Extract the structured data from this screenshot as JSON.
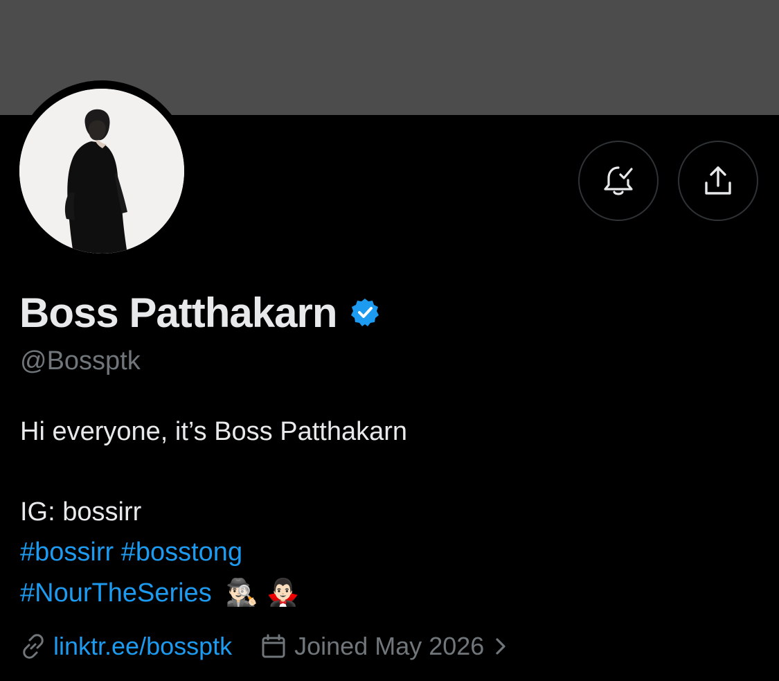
{
  "profile": {
    "display_name": "Boss Patthakarn",
    "handle": "@Bossptk",
    "verified_icon": "verified-badge-icon",
    "bio": {
      "line1": "Hi everyone, it’s Boss Patthakarn",
      "line2": "IG: bossirr",
      "hashtag1": "#bossirr",
      "hashtag2": "#bosstong",
      "hashtag3": "#NourTheSeries",
      "emoji1": "🕵🏻‍♂️",
      "emoji2": "🧛🏻‍♂️"
    },
    "link_text": "linktr.ee/bossptk",
    "joined_text": "Joined May 2026"
  },
  "actions": {
    "notify_icon": "bell-check-icon",
    "share_icon": "share-icon"
  },
  "colors": {
    "banner": "#4c4c4c",
    "background": "#000000",
    "accent": "#1d9bf0",
    "muted": "#71767b",
    "text": "#e7e9ea"
  }
}
